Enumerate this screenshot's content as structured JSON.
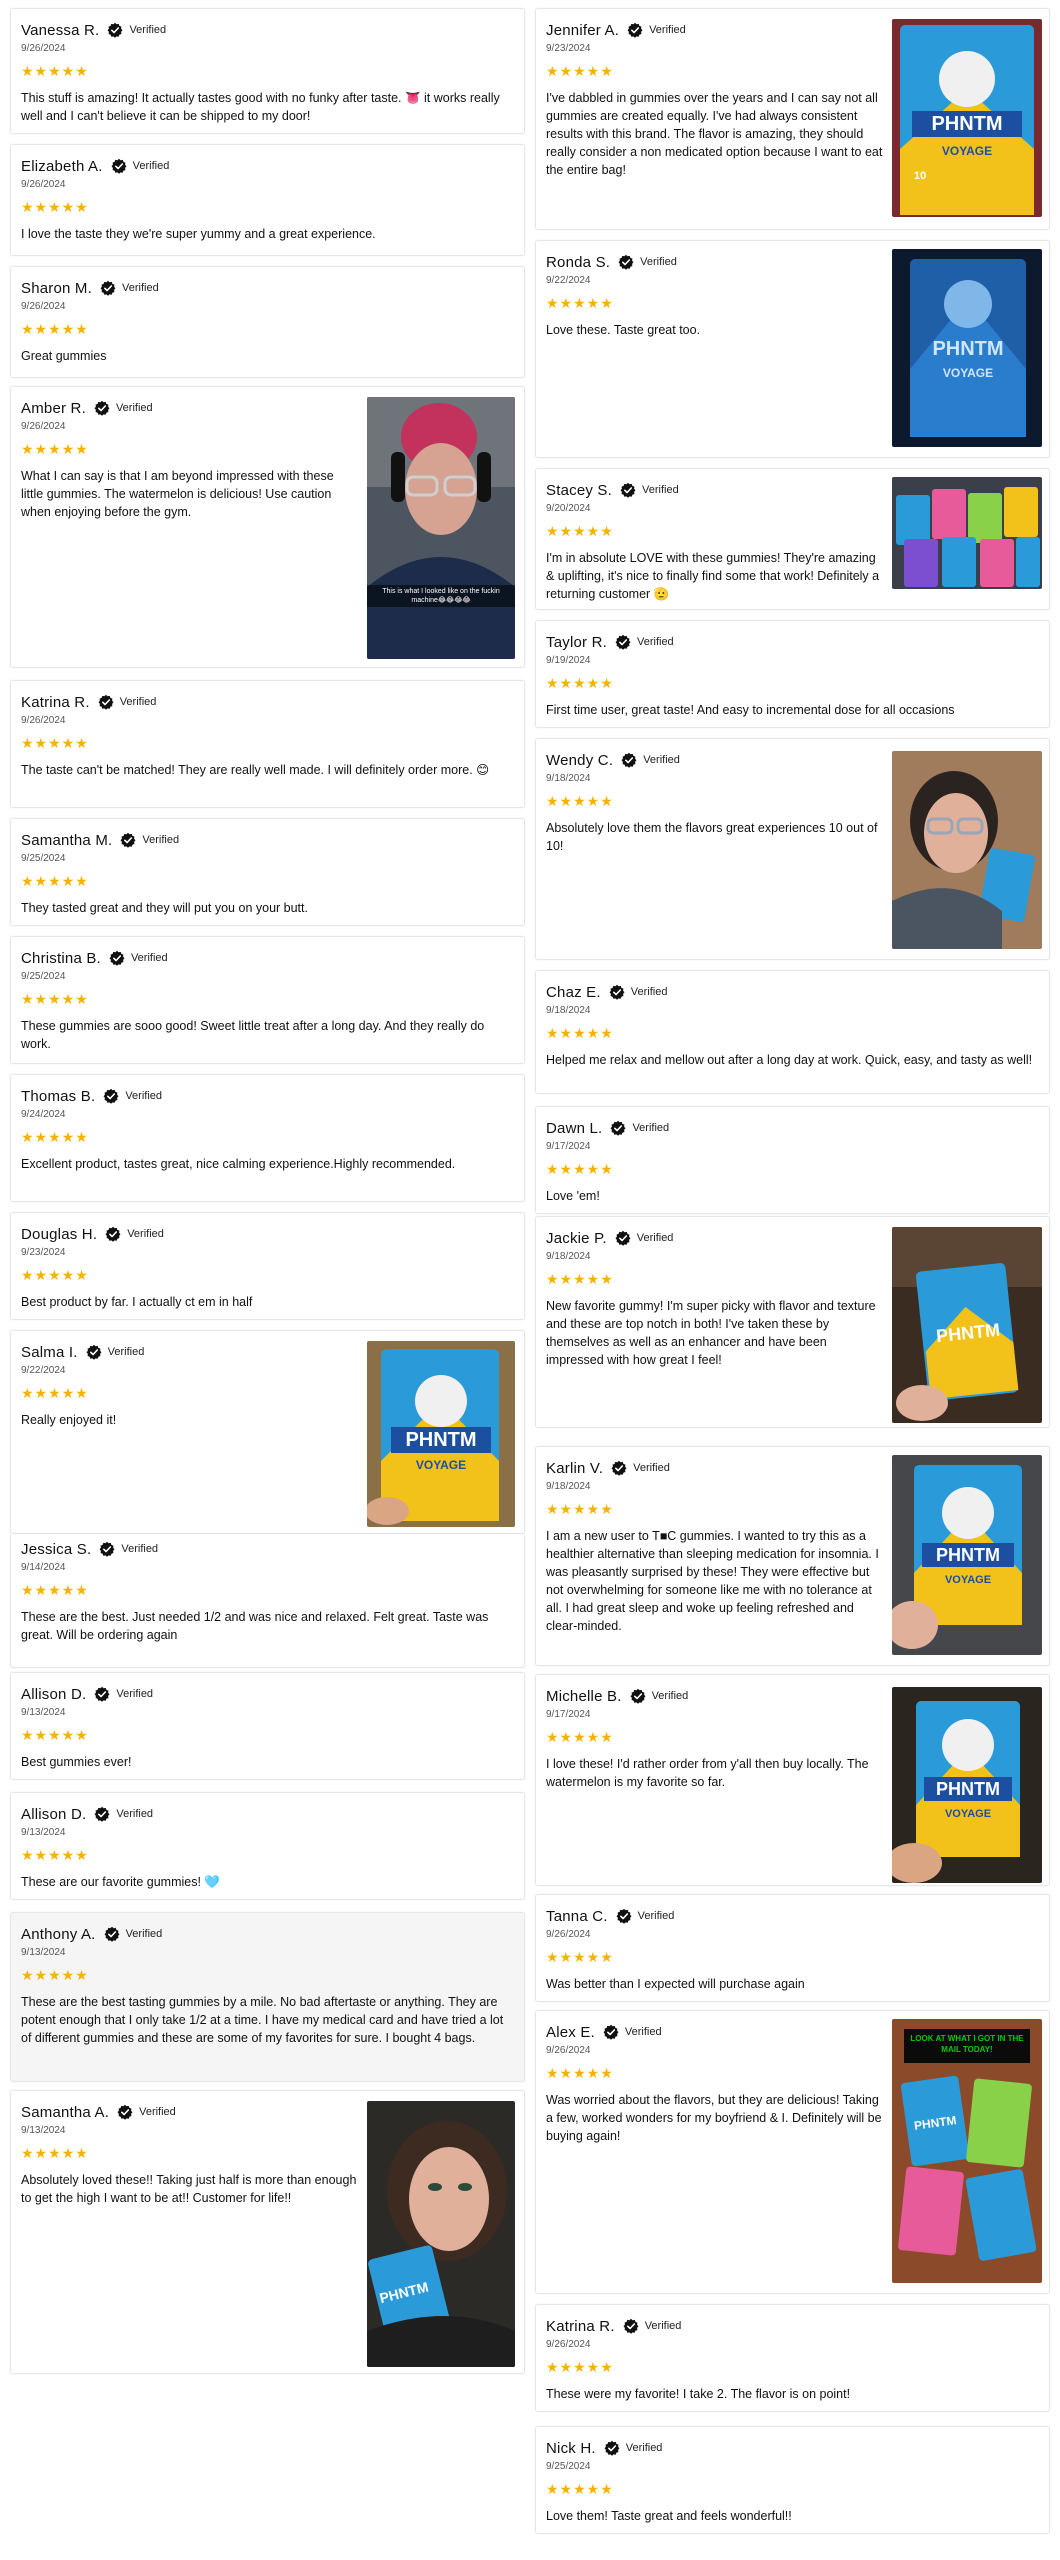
{
  "verified_label": "Verified",
  "star_color": "#f5b301",
  "left_reviews": [
    {
      "name": "Vanessa R.",
      "date": "9/26/2024",
      "stars": "★★★★★",
      "text": "This stuff is amazing! It actually tastes good with no funky after taste. 👅 it works really well and I can't believe it can be shipped to my door!"
    },
    {
      "name": "Elizabeth A.",
      "date": "9/26/2024",
      "stars": "★★★★★",
      "text": "I love the taste they we're super yummy and a great experience."
    },
    {
      "name": "Sharon M.",
      "date": "9/26/2024",
      "stars": "★★★★★",
      "text": "Great gummies"
    },
    {
      "name": "Amber R.",
      "date": "9/26/2024",
      "stars": "★★★★★",
      "text": "What I can say is that I am beyond impressed with these little gummies. The watermelon is delicious! Use caution when enjoying before the gym.",
      "photo_caption": "This is what I looked like on the fuckin machine😂😂😂😂"
    },
    {
      "name": "Katrina R.",
      "date": "9/26/2024",
      "stars": "★★★★★",
      "text": "The taste can't be matched! They are really well made. I will definitely order more. 😊"
    },
    {
      "name": "Samantha M.",
      "date": "9/25/2024",
      "stars": "★★★★★",
      "text": "They tasted great and they will put you on your butt."
    },
    {
      "name": "Christina B.",
      "date": "9/25/2024",
      "stars": "★★★★★",
      "text": "These gummies are sooo good! Sweet little treat after a long day. And they really do work."
    },
    {
      "name": "Thomas B.",
      "date": "9/24/2024",
      "stars": "★★★★★",
      "text": "Excellent product, tastes great, nice calming experience.Highly recommended."
    },
    {
      "name": "Douglas H.",
      "date": "9/23/2024",
      "stars": "★★★★★",
      "text": "Best product by far. I actually ct em in half"
    },
    {
      "name": "Salma I.",
      "date": "9/22/2024",
      "stars": "★★★★★",
      "text": "Really enjoyed it!"
    },
    {
      "name": "Jessica S.",
      "date": "9/14/2024",
      "stars": "★★★★★",
      "text": "These are the best. Just needed 1/2 and was nice and relaxed. Felt great. Taste was great. Will be ordering again"
    },
    {
      "name": "Allison D.",
      "date": "9/13/2024",
      "stars": "★★★★★",
      "text": "Best gummies ever!"
    },
    {
      "name": "Allison D.",
      "date": "9/13/2024",
      "stars": "★★★★★",
      "text": "These are our favorite gummies! 🩵"
    },
    {
      "name": "Anthony A.",
      "date": "9/13/2024",
      "stars": "★★★★★",
      "text": "These are the best tasting gummies by a mile. No bad aftertaste or anything. They are potent enough that I only take 1/2 at a time. I have my medical card and have tried a lot of different gummies and these are some of my favorites for sure. I bought 4 bags."
    },
    {
      "name": "Samantha A.",
      "date": "9/13/2024",
      "stars": "★★★★★",
      "text": "Absolutely loved these!! Taking just half is more than enough to get the high I want to be at!! Customer for life!!"
    }
  ],
  "right_reviews": [
    {
      "name": "Jennifer A.",
      "date": "9/23/2024",
      "stars": "★★★★★",
      "text": "I've dabbled in gummies over the years and I can say not all gummies are created equally. I've had always consistent results with this brand. The flavor is amazing, they should really consider a non medicated option because I want to eat the entire bag!"
    },
    {
      "name": "Ronda S.",
      "date": "9/22/2024",
      "stars": "★★★★★",
      "text": "Love these. Taste great too."
    },
    {
      "name": "Stacey S.",
      "date": "9/20/2024",
      "stars": "★★★★★",
      "text": "I'm in absolute LOVE with these gummies! They're amazing & uplifting, it's nice to finally find some that work! Definitely a returning customer 🫡"
    },
    {
      "name": "Taylor R.",
      "date": "9/19/2024",
      "stars": "★★★★★",
      "text": "First time user, great taste! And easy to incremental dose for all occasions"
    },
    {
      "name": "Wendy C.",
      "date": "9/18/2024",
      "stars": "★★★★★",
      "text": "Absolutely love them the flavors great experiences 10 out of 10!"
    },
    {
      "name": "Chaz E.",
      "date": "9/18/2024",
      "stars": "★★★★★",
      "text": "Helped me relax and mellow out after a long day at work. Quick, easy, and tasty as well!"
    },
    {
      "name": "Dawn L.",
      "date": "9/17/2024",
      "stars": "★★★★★",
      "text": "Love 'em!"
    },
    {
      "name": "Jackie P.",
      "date": "9/18/2024",
      "stars": "★★★★★",
      "text": "New favorite gummy! I'm super picky with flavor and texture and these are top notch in both! I've taken these by themselves as well as an enhancer and have been impressed with how great I feel!"
    },
    {
      "name": "Karlin V.",
      "date": "9/18/2024",
      "stars": "★★★★★",
      "text": "I am a new user to T■C gummies. I wanted to try this as a healthier alternative than sleeping medication for insomnia. I was pleasantly surprised by these! They were effective but not overwhelming for someone like me with no tolerance at all. I had great sleep and woke up feeling refreshed and clear-minded."
    },
    {
      "name": "Michelle B.",
      "date": "9/17/2024",
      "stars": "★★★★★",
      "text": "I love these! I'd rather order from y'all then buy locally. The watermelon is my favorite so far."
    },
    {
      "name": "Tanna C.",
      "date": "9/26/2024",
      "stars": "★★★★★",
      "text": "Was better than I expected will purchase again"
    },
    {
      "name": "Alex E.",
      "date": "9/26/2024",
      "stars": "★★★★★",
      "text": "Was worried about the flavors, but they are delicious! Taking a few, worked wonders for my boyfriend & I. Definitely will be buying again!",
      "photo_caption": "LOOK AT WHAT I GOT IN THE MAIL TODAY!"
    },
    {
      "name": "Katrina R.",
      "date": "9/26/2024",
      "stars": "★★★★★",
      "text": "These were my favorite! I take 2. The flavor is on point!"
    },
    {
      "name": "Nick H.",
      "date": "9/25/2024",
      "stars": "★★★★★",
      "text": "Love them! Taste great and feels wonderful!!"
    }
  ],
  "product_bag": {
    "brand": "PHNTM",
    "line": "VOYAGE",
    "count": "10"
  }
}
